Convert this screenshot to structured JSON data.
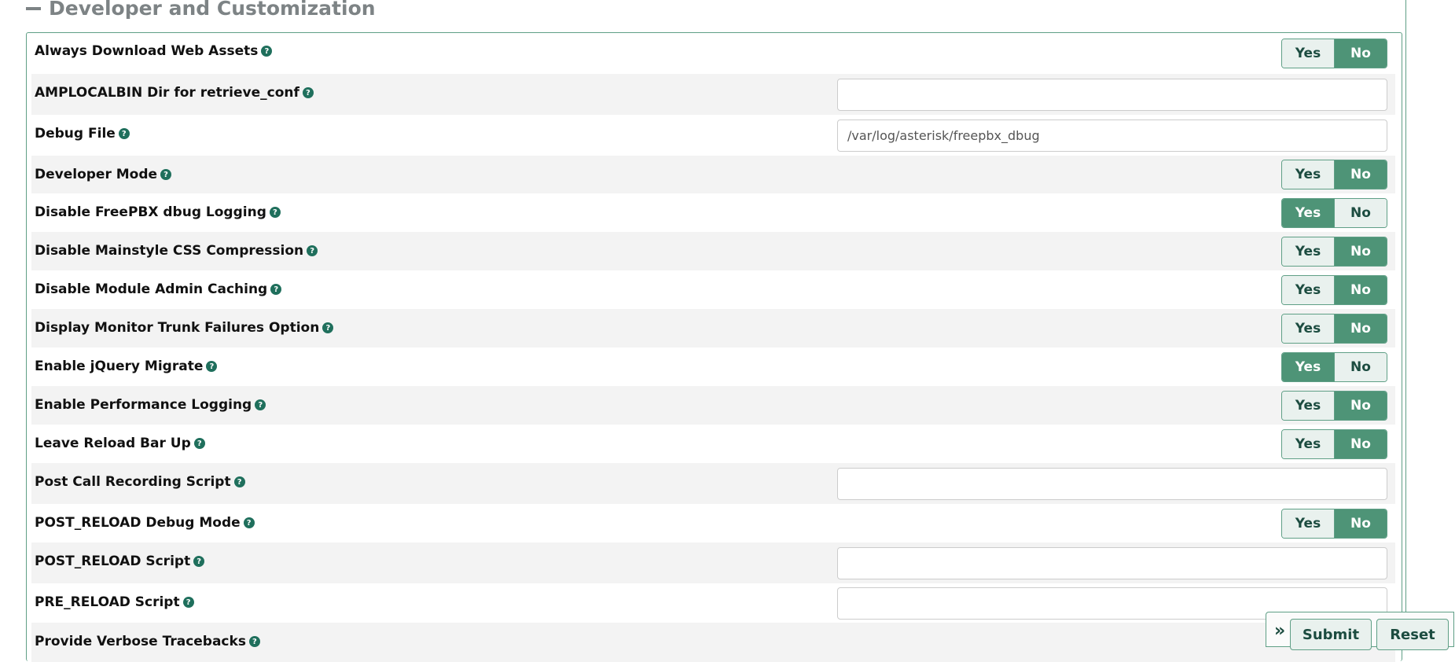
{
  "section": {
    "title": "Developer and Customization"
  },
  "rows": [
    {
      "label": "Always Download Web Assets",
      "control": "toggle",
      "value": "No"
    },
    {
      "label": "AMPLOCALBIN Dir for retrieve_conf",
      "control": "input",
      "value": ""
    },
    {
      "label": "Debug File",
      "control": "input",
      "value": "/var/log/asterisk/freepbx_dbug"
    },
    {
      "label": "Developer Mode",
      "control": "toggle",
      "value": "No"
    },
    {
      "label": "Disable FreePBX dbug Logging",
      "control": "toggle",
      "value": "Yes"
    },
    {
      "label": "Disable Mainstyle CSS Compression",
      "control": "toggle",
      "value": "No"
    },
    {
      "label": "Disable Module Admin Caching",
      "control": "toggle",
      "value": "No"
    },
    {
      "label": "Display Monitor Trunk Failures Option",
      "control": "toggle",
      "value": "No"
    },
    {
      "label": "Enable jQuery Migrate",
      "control": "toggle",
      "value": "Yes"
    },
    {
      "label": "Enable Performance Logging",
      "control": "toggle",
      "value": "No"
    },
    {
      "label": "Leave Reload Bar Up",
      "control": "toggle",
      "value": "No"
    },
    {
      "label": "Post Call Recording Script",
      "control": "input",
      "value": ""
    },
    {
      "label": "POST_RELOAD Debug Mode",
      "control": "toggle",
      "value": "No"
    },
    {
      "label": "POST_RELOAD Script",
      "control": "input",
      "value": ""
    },
    {
      "label": "PRE_RELOAD Script",
      "control": "input",
      "value": ""
    },
    {
      "label": "Provide Verbose Tracebacks",
      "control": "none",
      "value": ""
    }
  ],
  "toggle_labels": {
    "yes": "Yes",
    "no": "No"
  },
  "help_glyph": "?",
  "actions": {
    "submit": "Submit",
    "reset": "Reset",
    "toggle_glyph": "»"
  },
  "colors": {
    "accent": "#4e9477",
    "accent_light": "#e9f1ee",
    "border": "#5f9f86",
    "help_icon": "#1f6f5c"
  }
}
